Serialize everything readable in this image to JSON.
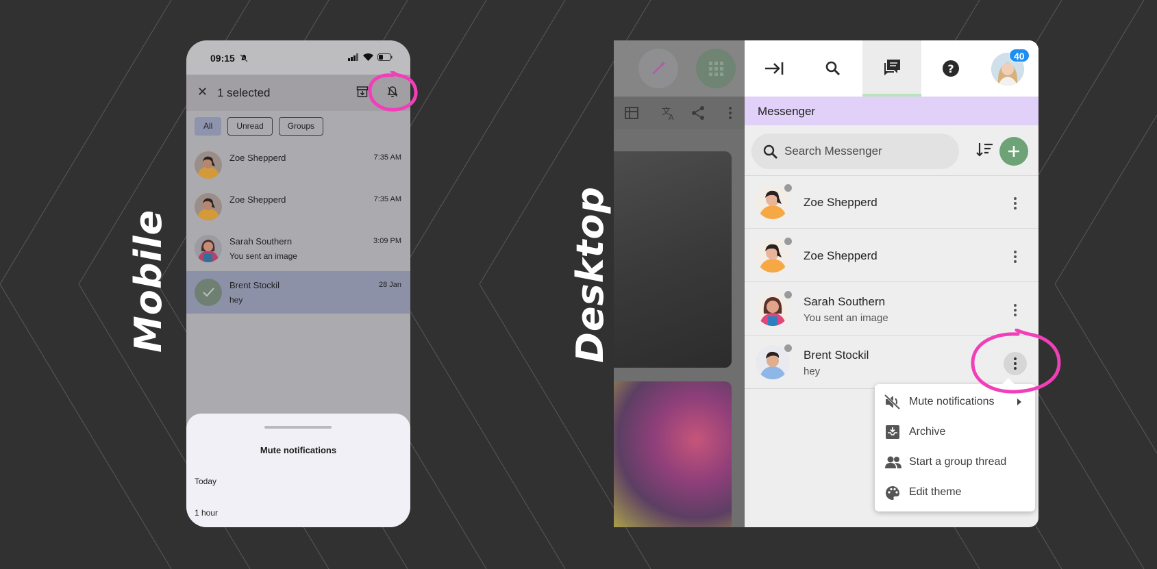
{
  "labels": {
    "mobile": "Mobile",
    "desktop": "Desktop"
  },
  "colors": {
    "background": "#323131",
    "highlight": "#f03fb8",
    "messenger_header": "#e1d1f8",
    "add_button": "#6ea277",
    "badge": "#1e8ff0"
  },
  "mobile": {
    "status": {
      "time": "09:15"
    },
    "selection": {
      "count_text": "1 selected"
    },
    "filters": [
      "All",
      "Unread",
      "Groups"
    ],
    "conversations": [
      {
        "name": "Zoe Shepperd",
        "time": "7:35 AM",
        "preview": ""
      },
      {
        "name": "Zoe Shepperd",
        "time": "7:35 AM",
        "preview": ""
      },
      {
        "name": "Sarah Southern",
        "time": "3:09 PM",
        "preview": "You sent an image"
      },
      {
        "name": "Brent Stockil",
        "time": "28 Jan",
        "preview": "hey",
        "selected": true
      }
    ],
    "sheet": {
      "title": "Mute notifications",
      "options": [
        "Today",
        "1 hour"
      ]
    }
  },
  "desktop": {
    "nav": {
      "badge_count": "40",
      "icons": [
        "collapse-panel-icon",
        "search-icon",
        "messenger-icon",
        "help-icon"
      ]
    },
    "header": "Messenger",
    "search": {
      "placeholder": "Search Messenger"
    },
    "conversations": [
      {
        "name": "Zoe Shepperd",
        "preview": ""
      },
      {
        "name": "Zoe Shepperd",
        "preview": ""
      },
      {
        "name": "Sarah Southern",
        "preview": "You sent an image"
      },
      {
        "name": "Brent Stockil",
        "preview": "hey"
      }
    ],
    "menu": [
      "Mute notifications",
      "Archive",
      "Start a group thread",
      "Edit theme"
    ]
  }
}
